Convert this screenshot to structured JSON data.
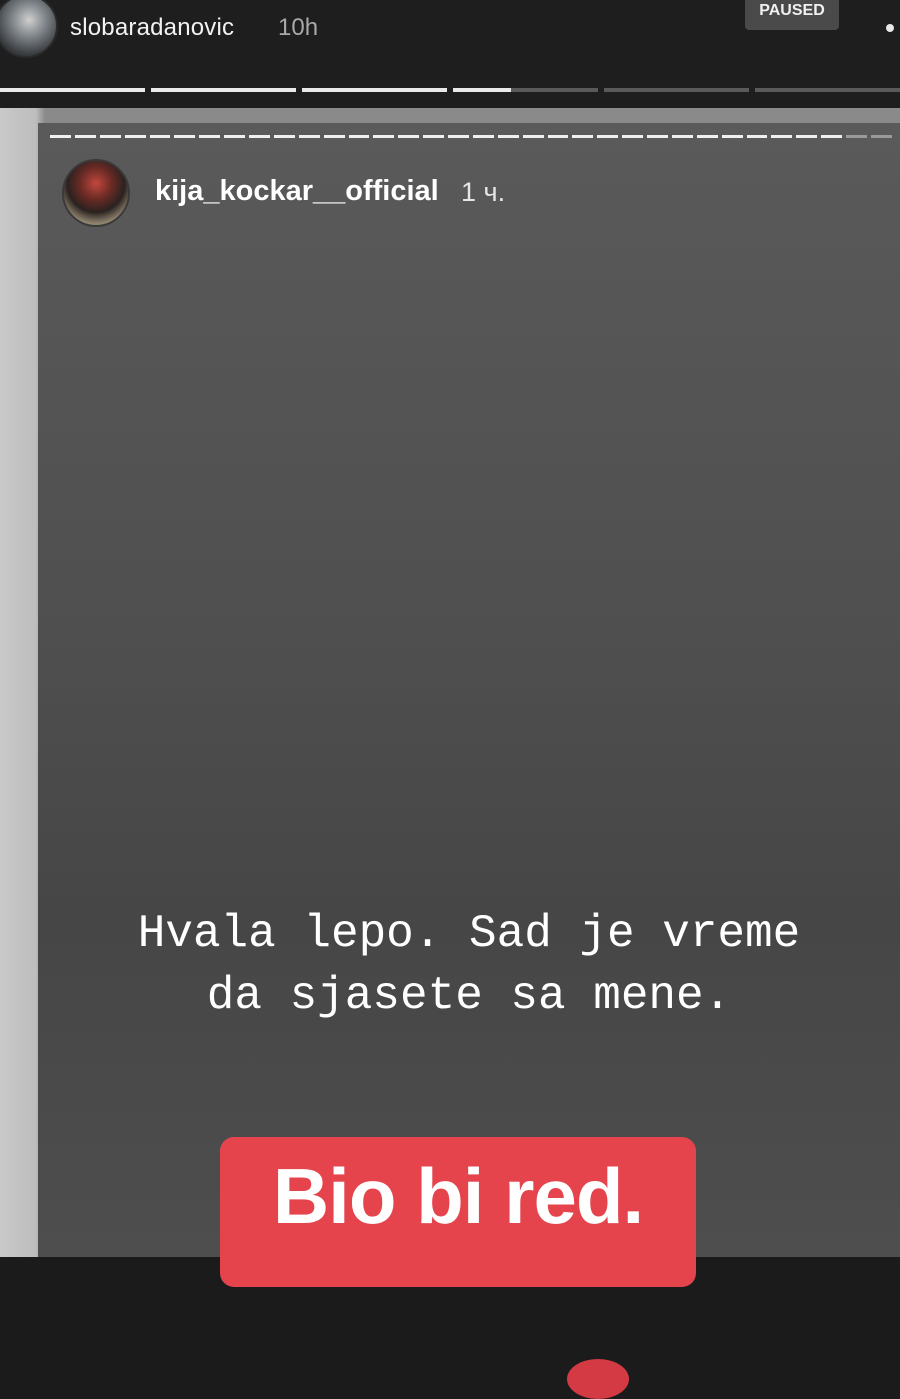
{
  "outer": {
    "username": "slobaradanovic",
    "time": "10h",
    "paused_badge": "PAUSED",
    "progress_segments": [
      1,
      1,
      1,
      0.4,
      0,
      0
    ],
    "menu_icon": "more-dots-icon"
  },
  "story": {
    "username": "kija_kockar__official",
    "time": "1 ч.",
    "progress_ticks": 34,
    "message": "Hvala lepo. Sad je vreme\nda sjasete sa mene.",
    "label": "Bio bi red.",
    "label_color": "#e5444c",
    "background_color": "#4f4f4f"
  }
}
